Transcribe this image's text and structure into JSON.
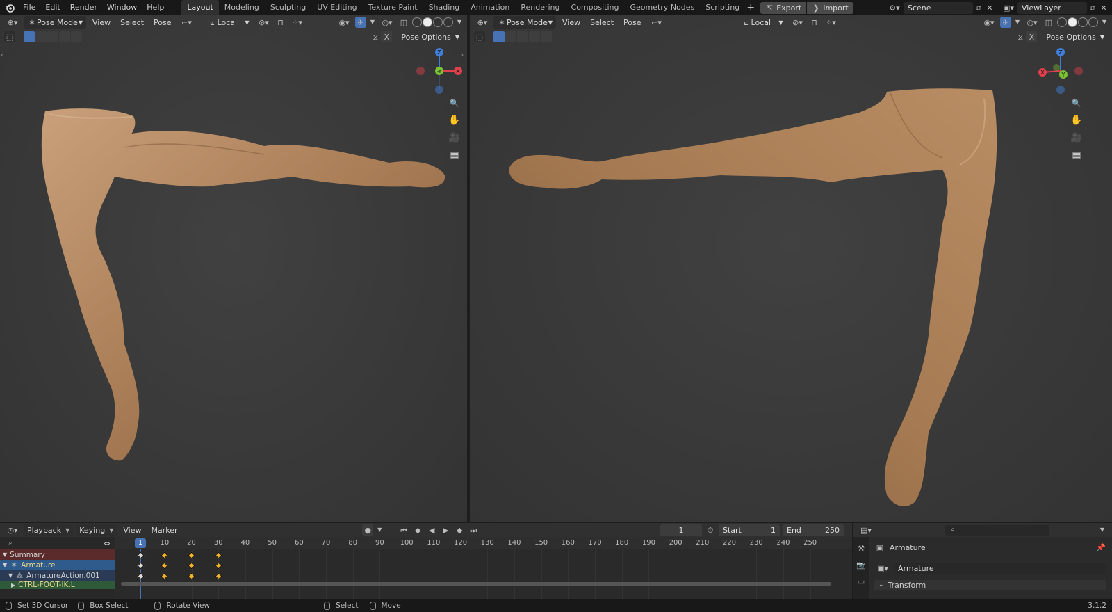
{
  "topbar": {
    "menus": [
      "File",
      "Edit",
      "Render",
      "Window",
      "Help"
    ],
    "workspaces": [
      "Layout",
      "Modeling",
      "Sculpting",
      "UV Editing",
      "Texture Paint",
      "Shading",
      "Animation",
      "Rendering",
      "Compositing",
      "Geometry Nodes",
      "Scripting"
    ],
    "active_workspace": "Layout",
    "export_label": "Export",
    "import_label": "Import",
    "scene_name": "Scene",
    "view_layer_name": "ViewLayer"
  },
  "viewport_left": {
    "mode": "Pose Mode",
    "menus": [
      "View",
      "Select",
      "Pose"
    ],
    "transform_orientation": "Local",
    "pose_options": "Pose Options"
  },
  "viewport_right": {
    "mode": "Pose Mode",
    "menus": [
      "View",
      "Select",
      "Pose"
    ],
    "transform_orientation": "Local",
    "pose_options": "Pose Options"
  },
  "gizmo_axes": {
    "x": "X",
    "y": "Y",
    "z": "Z",
    "neg_y": "-Y"
  },
  "timeline": {
    "menus": [
      "Playback",
      "Keying",
      "View",
      "Marker"
    ],
    "current_frame": "1",
    "start_label": "Start",
    "start_value": "1",
    "end_label": "End",
    "end_value": "250",
    "ruler_ticks": [
      "10",
      "20",
      "30",
      "40",
      "50",
      "60",
      "70",
      "80",
      "90",
      "100",
      "110",
      "120",
      "130",
      "140",
      "150",
      "160",
      "170",
      "180",
      "190",
      "200",
      "210",
      "220",
      "230",
      "240",
      "250"
    ],
    "playhead_label": "1",
    "channels": [
      "Summary",
      "Armature",
      "ArmatureAction.001",
      "CTRL-FOOT-IK.L"
    ],
    "keyframes": [
      1,
      10,
      20,
      30
    ]
  },
  "properties": {
    "object_name": "Armature",
    "data_name": "Armature",
    "section": "Transform"
  },
  "status": {
    "items": [
      "Set 3D Cursor",
      "Box Select",
      "Rotate View",
      "Select",
      "Move"
    ],
    "version": "3.1.2"
  },
  "colors": {
    "accent": "#4772b3",
    "skin": "#b08660",
    "x_axis": "#e0414c",
    "y_axis": "#7ac233",
    "z_axis": "#3f7dd6",
    "keyframe": "#f0b32a",
    "summary_row": "#5b2a2a",
    "armature_row": "#2f5b8c"
  }
}
